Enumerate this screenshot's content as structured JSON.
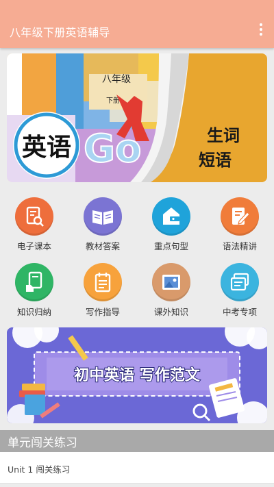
{
  "app": {
    "title": "八年级下册英语辅导",
    "menu_icon": "more-vertical-icon",
    "bar_color": "#f6ac93"
  },
  "banner": {
    "grade": "八年级",
    "volume": "下册",
    "subject": "英语",
    "art_text": "Go for",
    "line1": "生词",
    "line2": "短语"
  },
  "menu": [
    {
      "label": "电子课本",
      "icon": "ebook-search-icon",
      "color": "#ee6e3c"
    },
    {
      "label": "教材答案",
      "icon": "open-book-icon",
      "color": "#7b74d3"
    },
    {
      "label": "重点句型",
      "icon": "wallet-house-icon",
      "color": "#1fa3da"
    },
    {
      "label": "语法精讲",
      "icon": "document-pen-icon",
      "color": "#f07c3a"
    },
    {
      "label": "知识归纳",
      "icon": "hand-document-icon",
      "color": "#2fb565"
    },
    {
      "label": "写作指导",
      "icon": "notepad-icon",
      "color": "#f7a23c"
    },
    {
      "label": "课外知识",
      "icon": "picture-icon",
      "color": "#d99a6b"
    },
    {
      "label": "中考专项",
      "icon": "cards-icon",
      "color": "#3bb4df"
    }
  ],
  "promo": {
    "title": "初中英语 写作范文"
  },
  "section": {
    "title": "单元闯关练习"
  },
  "list": [
    {
      "label": "Unit 1 闯关练习"
    }
  ]
}
